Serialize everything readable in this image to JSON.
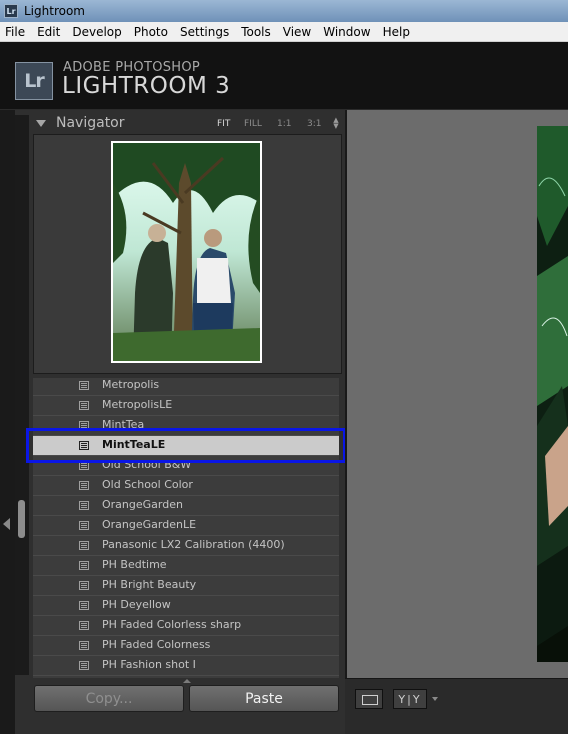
{
  "window": {
    "title": "Lightroom"
  },
  "menubar": {
    "items": [
      "File",
      "Edit",
      "Develop",
      "Photo",
      "Settings",
      "Tools",
      "View",
      "Window",
      "Help"
    ]
  },
  "identity": {
    "logo_text": "Lr",
    "brand_top": "ADOBE PHOTOSHOP",
    "brand_main": "LIGHTROOM 3"
  },
  "navigator": {
    "title": "Navigator",
    "zoom_options": [
      "FIT",
      "FILL",
      "1:1",
      "3:1"
    ],
    "selected_zoom": "FIT"
  },
  "presets": {
    "items": [
      "Metropolis",
      "MetropolisLE",
      "MintTea",
      "MintTeaLE",
      "Old School B&W",
      "Old School Color",
      "OrangeGarden",
      "OrangeGardenLE",
      "Panasonic LX2 Calibration (4400)",
      "PH Bedtime",
      "PH Bright Beauty",
      "PH Deyellow",
      "PH Faded Colorless sharp",
      "PH Faded Colorness",
      "PH Fashion shot I"
    ],
    "selected": "MintTeaLE"
  },
  "buttons": {
    "copy_label": "Copy...",
    "paste_label": "Paste"
  },
  "toolbar": {
    "compare_label": "Y|Y"
  },
  "colors": {
    "selection_outline": "#0a16e6",
    "panel_bg": "#2f2f2f",
    "preview_bg": "#6c6c6c"
  },
  "icons": [
    "lightroom-app-icon",
    "navigator-collapse-triangle",
    "zoom-stepper-icon",
    "preset-icon",
    "loupe-view-icon",
    "compare-view-icon",
    "left-panel-arrow-icon"
  ]
}
